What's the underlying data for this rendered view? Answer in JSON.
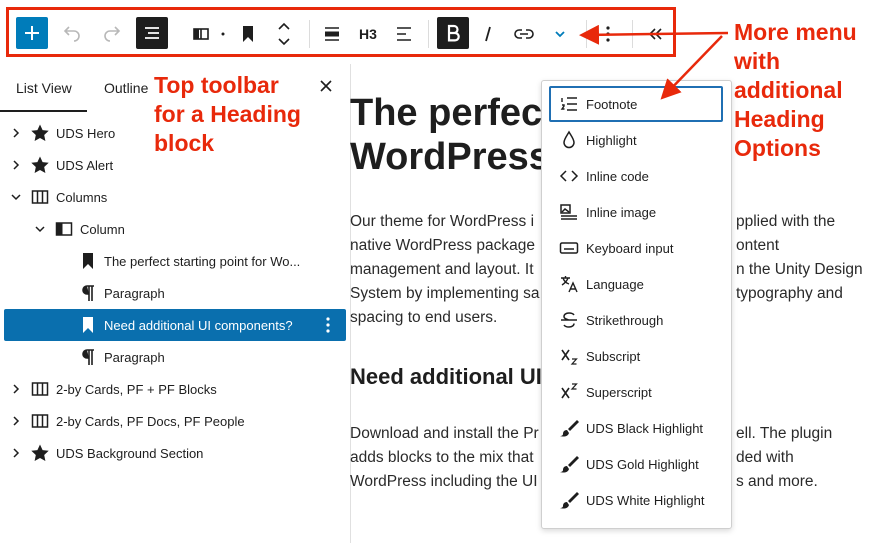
{
  "toolbar": {
    "heading_level_label": "H3",
    "accent_color": "#007cba",
    "highlight_color": "#e8290b"
  },
  "sidebar": {
    "tabs": [
      {
        "label": "List View"
      },
      {
        "label": "Outline"
      }
    ],
    "tree": [
      {
        "label": "UDS Hero",
        "icon": "star-icon"
      },
      {
        "label": "UDS Alert",
        "icon": "star-icon"
      },
      {
        "label": "Columns",
        "icon": "columns-icon"
      },
      {
        "label": "Column",
        "icon": "column-icon"
      },
      {
        "label": "The perfect starting point for Wo...",
        "icon": "bookmark-icon"
      },
      {
        "label": "Paragraph",
        "icon": "paragraph-icon"
      },
      {
        "label": "Need additional UI components?",
        "icon": "bookmark-icon",
        "selected": true
      },
      {
        "label": "Paragraph",
        "icon": "paragraph-icon"
      },
      {
        "label": "2-by Cards, PF + PF Blocks",
        "icon": "columns-icon"
      },
      {
        "label": "2-by Cards, PF Docs, PF People",
        "icon": "columns-icon"
      },
      {
        "label": "UDS Background Section",
        "icon": "star-icon"
      }
    ]
  },
  "editor": {
    "h1_line1": "The perfect",
    "h1_line2": "WordPress",
    "p1_lines": [
      "Our theme for WordPress i",
      "native WordPress package",
      "management and layout. It",
      "System by implementing sa",
      "spacing to end users."
    ],
    "p1_right_lines": [
      "pplied with the",
      "ontent",
      "n the Unity Design",
      "typography and"
    ],
    "h2": "Need additional UI",
    "p2_lines": [
      "Download and install the Pr",
      "adds blocks to the mix that",
      "WordPress including the UI"
    ],
    "p2_right_lines": [
      "ell. The plugin",
      "ded with",
      "s and more."
    ]
  },
  "more_menu": {
    "items": [
      {
        "label": "Footnote",
        "icon": "footnote-icon"
      },
      {
        "label": "Highlight",
        "icon": "droplet-icon"
      },
      {
        "label": "Inline code",
        "icon": "code-icon"
      },
      {
        "label": "Inline image",
        "icon": "inline-image-icon"
      },
      {
        "label": "Keyboard input",
        "icon": "keyboard-icon"
      },
      {
        "label": "Language",
        "icon": "language-icon"
      },
      {
        "label": "Strikethrough",
        "icon": "strikethrough-icon"
      },
      {
        "label": "Subscript",
        "icon": "subscript-icon"
      },
      {
        "label": "Superscript",
        "icon": "superscript-icon"
      },
      {
        "label": "UDS Black Highlight",
        "icon": "brush-icon"
      },
      {
        "label": "UDS Gold Highlight",
        "icon": "brush-icon"
      },
      {
        "label": "UDS White Highlight",
        "icon": "brush-icon"
      }
    ]
  },
  "annotations": {
    "toolbar_note": [
      "Top toolbar",
      "for a Heading",
      "block"
    ],
    "menu_note": [
      "More menu",
      "with",
      "additional",
      "Heading",
      "Options"
    ]
  }
}
